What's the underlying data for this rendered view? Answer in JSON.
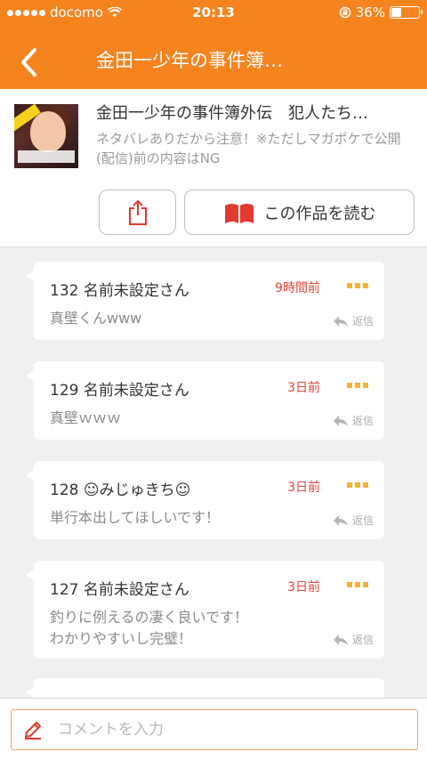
{
  "status": {
    "carrier": "docomo",
    "time": "20:13",
    "battery": "36%",
    "battery_level": 0.36
  },
  "nav": {
    "back_icon": "chevron-left-icon",
    "title": "金田一少年の事件簿…"
  },
  "work": {
    "title": "金田一少年の事件簿外伝　犯人たち…",
    "description": "ネタバレありだから注意！※ただしマガポケで公開(配信)前の内容はNG",
    "share_icon": "share-icon",
    "read_label": "この作品を読む",
    "read_icon": "book-icon"
  },
  "comments": [
    {
      "header": "132 名前未設定さん",
      "time": "9時間前",
      "body": "真壁くんwww",
      "reply": "返信"
    },
    {
      "header": "129 名前未設定さん",
      "time": "3日前",
      "body": "真壁ｗｗｗ",
      "reply": "返信"
    },
    {
      "header": "128 ☺みじゅきち☺",
      "time": "3日前",
      "body": "単行本出してほしいです！",
      "reply": "返信"
    },
    {
      "header": "127 名前未設定さん",
      "time": "3日前",
      "body": "釣りに例えるの凄く良いです！\nわかりやすいし完璧！",
      "reply": "返信"
    }
  ],
  "comment_input": {
    "placeholder": "コメントを入力",
    "icon": "pencil-icon"
  },
  "colors": {
    "accent": "#f5841f",
    "time": "#e0453a",
    "more_dots": "#f5b330",
    "book": "#e23a2e"
  }
}
